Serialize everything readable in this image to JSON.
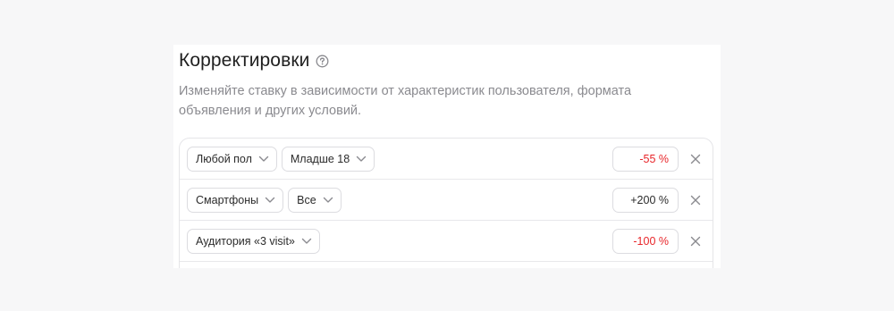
{
  "section": {
    "title": "Корректировки",
    "help_icon": "question-circle-icon",
    "subtitle_line1": "Изменяйте ставку в зависимости от характеристик пользователя, формата",
    "subtitle_line2": "объявления и других условий."
  },
  "adjustments": [
    {
      "chips": [
        "Любой пол",
        "Младше 18"
      ],
      "value": "-55 %",
      "negative": true
    },
    {
      "chips": [
        "Смартфоны",
        "Все"
      ],
      "value": "+200 %",
      "negative": false
    },
    {
      "chips": [
        "Аудитория «3 visit»"
      ],
      "value": "-100 %",
      "negative": true
    }
  ],
  "colors": {
    "negative": "#e8262a",
    "text": "#1f1f1f",
    "muted": "#8a8a8f",
    "border": "#dcdce0"
  },
  "icons": {
    "chip_chevron": "chevron-down-icon",
    "remove": "close-icon"
  }
}
